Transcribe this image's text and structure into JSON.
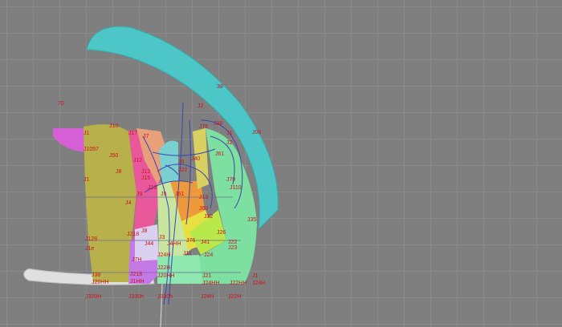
{
  "canvas": {
    "background": "#7f7f7f",
    "grid_color": "#9a9a9a",
    "label_color": "#c8141e",
    "curve_color": "#3a46b0"
  },
  "pieces": [
    {
      "id": "cyan-strip",
      "color": "#4cc6c6"
    },
    {
      "id": "magenta-cap",
      "color": "#d65fd6"
    },
    {
      "id": "olive-front",
      "color": "#b8b04a"
    },
    {
      "id": "pink-panel",
      "color": "#e8589a"
    },
    {
      "id": "salmon-panel",
      "color": "#e8a07a"
    },
    {
      "id": "violet-panel",
      "color": "#c47ae6"
    },
    {
      "id": "light-green-panel",
      "color": "#c8e6a0"
    },
    {
      "id": "orange-panel",
      "color": "#ee9a3a"
    },
    {
      "id": "yellow-panel",
      "color": "#e8e040"
    },
    {
      "id": "lime-panel",
      "color": "#b8e84a"
    },
    {
      "id": "mint-panel",
      "color": "#7ee0a0"
    },
    {
      "id": "white-strip",
      "color": "#e6e6e6"
    }
  ],
  "labels": {
    "l_70": "70",
    "l_38": "38",
    "l_2": "J2",
    "l_1": "J1",
    "l_306": "J06",
    "l_t10": "J10",
    "l_1057": "J1057",
    "l_50": "J50",
    "l_8": "J8",
    "l_l1": "J1",
    "l_17": "J17",
    "l_12": "J12",
    "l_13": "J13",
    "l_15": "J15",
    "l_16": "J16",
    "l_9": "J9",
    "l_4": "J4",
    "l_5": "J5",
    "l_61": "J61",
    "l_c0": "J0",
    "l_7": "J7",
    "l_22": "J22",
    "l_40": "J40",
    "l_76": "J76",
    "l_12b": "J128",
    "l_1e": "J1e",
    "l_38b": "J38",
    "l_218": "J218",
    "l_20hh": "J20HH",
    "l_320h": "J320H",
    "l_330h": "J330h",
    "l_1ha": "J1HH",
    "l_21": "J21",
    "l_22h": "J22H",
    "l_7h": "J7H",
    "l_13b": "J13",
    "l_24": "J24",
    "l_44": "J44",
    "l_11": "J11",
    "l_61b": "J61",
    "l_76b": "J76",
    "l_60": "J60",
    "l_26": "J26",
    "l_32": "J32",
    "l_8b": "J8",
    "l_3b": "J3",
    "l_4h": "J4HH",
    "l_24h": "J24H",
    "l_1b": "J1",
    "l_2b": "J2",
    "l_41": "J41",
    "l_22b": "J22",
    "l_22hh": "J22HH",
    "l_24hh": "J24HH",
    "l_23": "J23",
    "l_70b": "J70",
    "l_110": "J110",
    "l_35": "J35"
  }
}
